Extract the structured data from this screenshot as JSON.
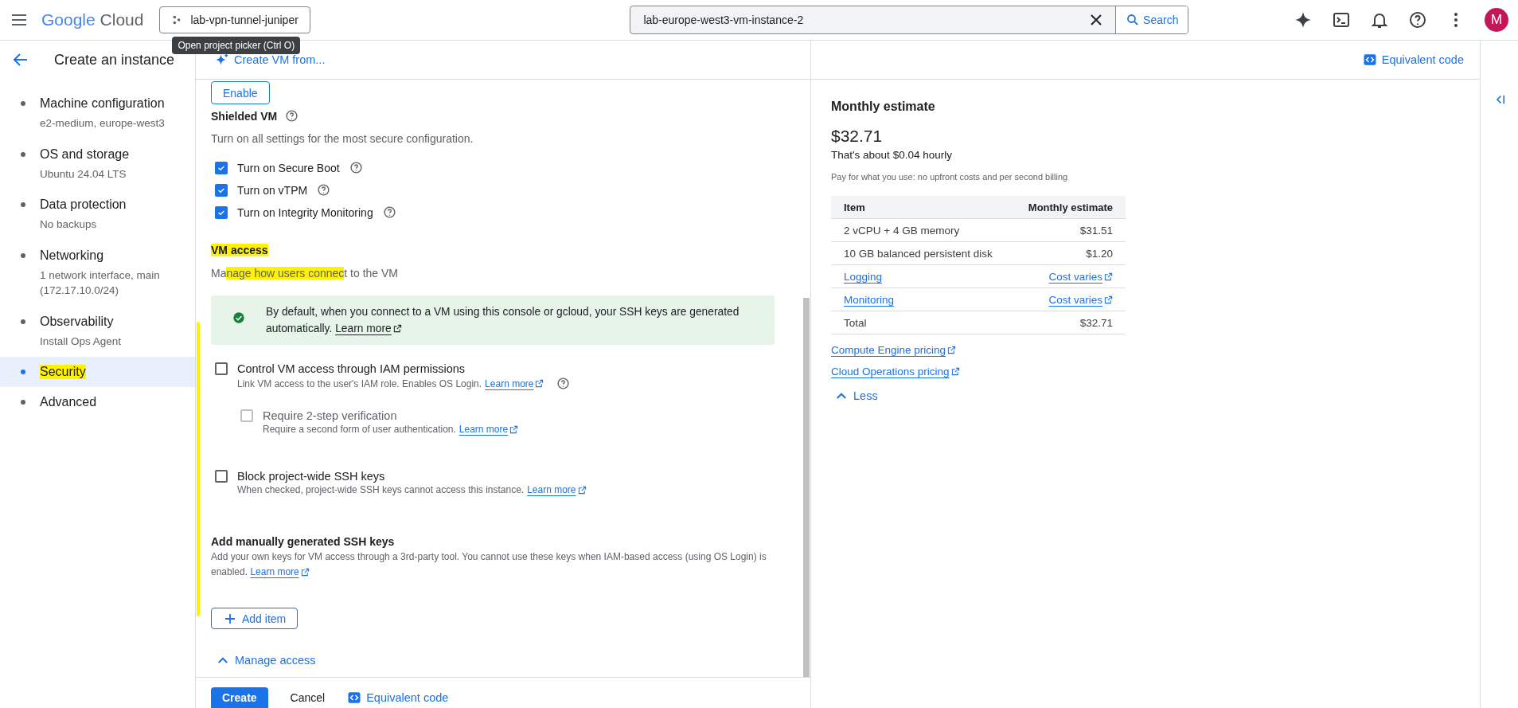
{
  "topbar": {
    "logo_brand": "Google",
    "logo_product": "Cloud",
    "project": "lab-vpn-tunnel-juniper",
    "tooltip": "Open project picker (Ctrl O)",
    "search_value": "lab-europe-west3-vm-instance-2",
    "search_button": "Search",
    "avatar": "M"
  },
  "header": {
    "title": "Create an instance",
    "create_from": "Create VM from...",
    "equivalent_code": "Equivalent code"
  },
  "sidebar": {
    "items": [
      {
        "title": "Machine configuration",
        "subtitle": "e2-medium, europe-west3",
        "selected": false,
        "highlighted": false
      },
      {
        "title": "OS and storage",
        "subtitle": "Ubuntu 24.04 LTS",
        "selected": false,
        "highlighted": false
      },
      {
        "title": "Data protection",
        "subtitle": "No backups",
        "selected": false,
        "highlighted": false
      },
      {
        "title": "Networking",
        "subtitle": "1 network interface, main (172.17.10.0/24)",
        "selected": false,
        "highlighted": false
      },
      {
        "title": "Observability",
        "subtitle": "Install Ops Agent",
        "selected": false,
        "highlighted": false
      },
      {
        "title": "Security",
        "selected": true,
        "highlighted": true
      },
      {
        "title": "Advanced",
        "selected": false,
        "highlighted": false
      }
    ]
  },
  "main": {
    "enable_button": "Enable",
    "shielded": {
      "title": "Shielded VM",
      "description": "Turn on all settings for the most secure configuration.",
      "options": [
        {
          "label": "Turn on Secure Boot",
          "checked": true
        },
        {
          "label": "Turn on vTPM",
          "checked": true
        },
        {
          "label": "Turn on Integrity Monitoring",
          "checked": true
        }
      ]
    },
    "vm_access": {
      "title": "VM access",
      "title_highlighted": true,
      "description_before": "Ma",
      "description_highlight": "nage how users connec",
      "description_after": "t to the VM",
      "banner": {
        "text": "By default, when you connect to a VM using this console or gcloud, your SSH keys are generated automatically.",
        "link": "Learn more"
      },
      "options": [
        {
          "label": "Control VM access through IAM permissions",
          "description": "Link VM access to the user's IAM role. Enables OS Login.",
          "link": "Learn more",
          "help": true,
          "checked": false,
          "disabled": false,
          "nested": false
        },
        {
          "label": "Require 2-step verification",
          "description": "Require a second form of user authentication.",
          "link": "Learn more",
          "help": false,
          "checked": false,
          "disabled": true,
          "nested": true
        },
        {
          "label": "Block project-wide SSH keys",
          "description": "When checked, project-wide SSH keys cannot access this instance.",
          "link": "Learn more",
          "help": false,
          "checked": false,
          "disabled": false,
          "nested": false
        }
      ]
    },
    "ssh_keys": {
      "title": "Add manually generated SSH keys",
      "description": "Add your own keys for VM access through a 3rd-party tool. You cannot use these keys when IAM-based access (using OS Login) is enabled.",
      "link": "Learn more",
      "add_button": "Add item"
    },
    "manage_access": "Manage access"
  },
  "estimate": {
    "title": "Monthly estimate",
    "total": "$32.71",
    "hourly": "That's about $0.04 hourly",
    "note": "Pay for what you use: no upfront costs and per second billing",
    "columns": [
      "Item",
      "Monthly estimate"
    ],
    "rows": [
      {
        "kind": "plain",
        "item": "2 vCPU + 4 GB memory",
        "cost": "$31.51"
      },
      {
        "kind": "plain",
        "item": "10 GB balanced persistent disk",
        "cost": "$1.20"
      },
      {
        "kind": "link",
        "item": "Logging",
        "cost": "Cost varies"
      },
      {
        "kind": "link",
        "item": "Monitoring",
        "cost": "Cost varies"
      },
      {
        "kind": "plain",
        "item": "Total",
        "cost": "$32.71"
      }
    ],
    "links": [
      "Compute Engine pricing",
      "Cloud Operations pricing"
    ],
    "less": "Less"
  },
  "footer": {
    "create": "Create",
    "cancel": "Cancel",
    "equivalent_code": "Equivalent code"
  }
}
